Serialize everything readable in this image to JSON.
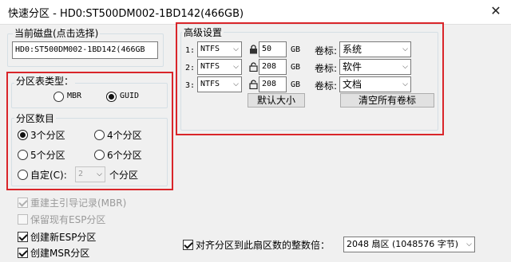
{
  "window": {
    "title": "快速分区 - HD0:ST500DM002-1BD142(466GB)",
    "close_icon": "close-icon"
  },
  "disk": {
    "label": "当前磁盘(点击选择)",
    "value": "HD0:ST500DM002-1BD142(466GB"
  },
  "partition_table": {
    "label": "分区表类型：",
    "options": [
      "MBR",
      "GUID"
    ],
    "selected": "GUID"
  },
  "partition_count": {
    "label": "分区数目",
    "options": [
      "3个分区",
      "4个分区",
      "5个分区",
      "6个分区"
    ],
    "selected": "3个分区",
    "custom_label": "自定(C):",
    "custom_value": "2",
    "custom_suffix": "个分区"
  },
  "options": {
    "rebuild_mbr": "重建主引导记录(MBR)",
    "keep_esp": "保留现有ESP分区",
    "create_esp": "创建新ESP分区",
    "create_msr": "创建MSR分区"
  },
  "advanced": {
    "label": "高级设置",
    "size_unit": "GB",
    "volume_label_text": "卷标:",
    "rows": [
      {
        "index": "1:",
        "fs": "NTFS",
        "size": "50",
        "locked": true,
        "volume": "系统"
      },
      {
        "index": "2:",
        "fs": "NTFS",
        "size": "208",
        "locked": false,
        "volume": "软件"
      },
      {
        "index": "3:",
        "fs": "NTFS",
        "size": "208",
        "locked": false,
        "volume": "文档"
      }
    ],
    "default_size_button": "默认大小",
    "clear_labels_button": "清空所有卷标"
  },
  "align": {
    "label": "对齐分区到此扇区数的整数倍：",
    "value": "2048 扇区 (1048576 字节)"
  },
  "colors": {
    "highlight": "#d9252a",
    "window_bg": "#f0f0f0"
  }
}
